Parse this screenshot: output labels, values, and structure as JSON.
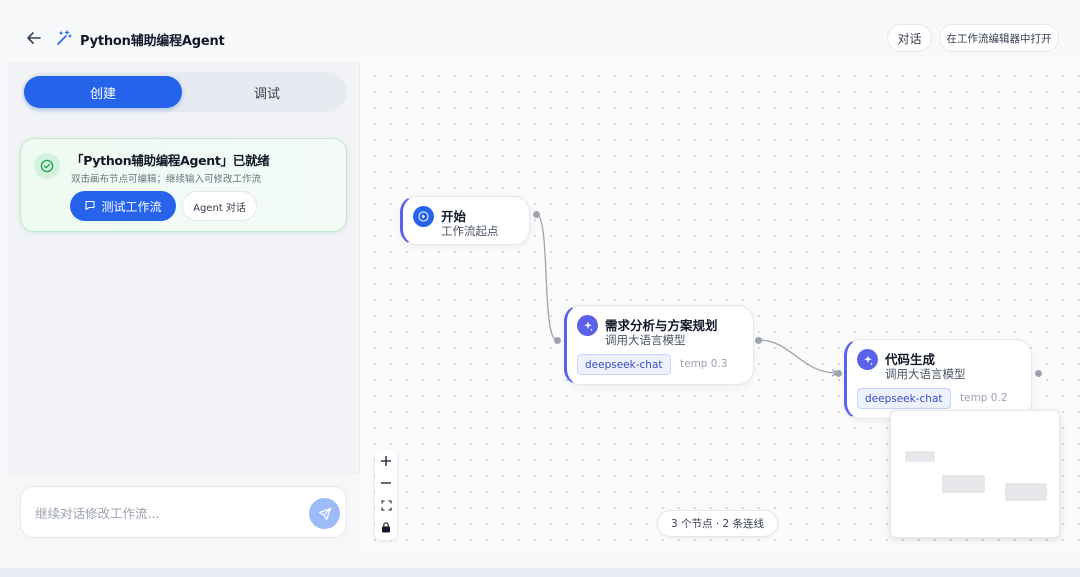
{
  "header": {
    "title": "Python辅助编程Agent",
    "chat_button": "对话",
    "open_editor_button": "在工作流编辑器中打开"
  },
  "left_panel": {
    "tabs": [
      {
        "label": "创建",
        "active": true
      },
      {
        "label": "调试",
        "active": false
      }
    ],
    "ready_card": {
      "title": "「Python辅助编程Agent」已就绪",
      "description": "双击画布节点可编辑；继续输入可修改工作流",
      "test_button": "测试工作流",
      "agent_button": "Agent 对话"
    },
    "input": {
      "value": "",
      "placeholder": "继续对话修改工作流..."
    }
  },
  "canvas": {
    "nodes": [
      {
        "title": "开始",
        "subtitle": "工作流起点"
      },
      {
        "title": "需求分析与方案规划",
        "subtitle": "调用大语言模型",
        "model": "deepseek-chat",
        "temp": "temp 0.3"
      },
      {
        "title": "代码生成",
        "subtitle": "调用大语言模型",
        "model": "deepseek-chat",
        "temp": "temp 0.2"
      }
    ],
    "stats": "3 个节点 · 2 条连线"
  },
  "colors": {
    "accent": "#2563eb",
    "node_accent": "#5b61e8",
    "success": "#16a34a"
  }
}
